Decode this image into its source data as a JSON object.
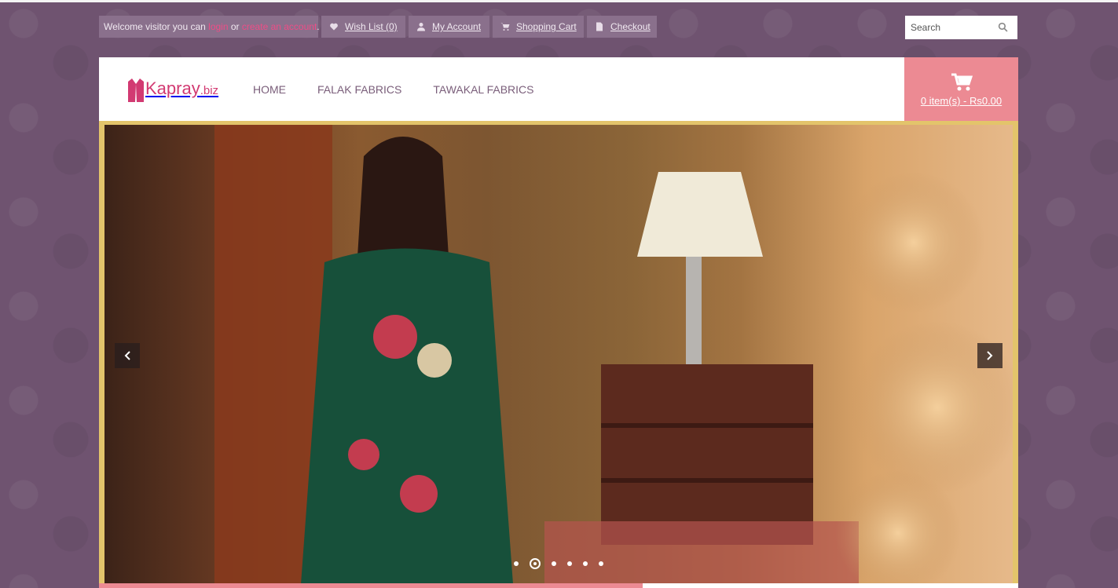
{
  "topbar": {
    "welcome_prefix": "Welcome visitor you can",
    "login_label": "login",
    "or_label": "or",
    "create_label": "create an account",
    "welcome_suffix": ".",
    "links": [
      {
        "label": "Wish List (0)",
        "icon": "heart-icon"
      },
      {
        "label": "My Account",
        "icon": "user-icon"
      },
      {
        "label": "Shopping Cart",
        "icon": "cart-icon"
      },
      {
        "label": "Checkout",
        "icon": "document-icon"
      }
    ],
    "search_placeholder": "Search"
  },
  "header": {
    "logo_text": "Kapray",
    "logo_suffix": ".biz",
    "nav": [
      "HOME",
      "FALAK FABRICS",
      "TAWAKAL FABRICS"
    ],
    "cart_summary": "0 item(s) - Rs0.00"
  },
  "slider": {
    "total_slides": 6,
    "active_slide": 2
  },
  "colors": {
    "background": "#6f5370",
    "topbar_button": "#8a708c",
    "accent_pink": "#ec8a93",
    "link_pink": "#ee4d86",
    "logo_pink": "#d23a72",
    "frame_gold": "#e3c46b",
    "nav_text": "#7a5e7a"
  }
}
